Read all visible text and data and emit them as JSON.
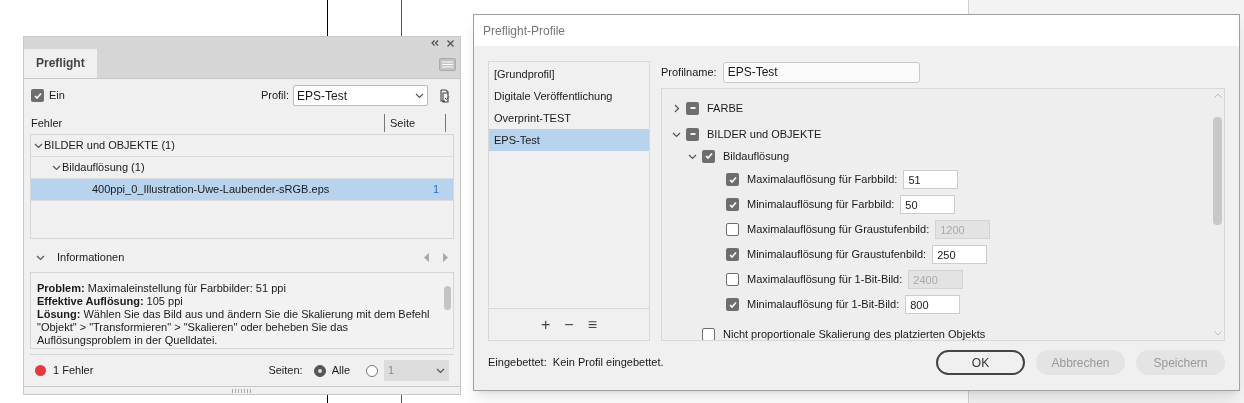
{
  "preflight_panel": {
    "tab": "Preflight",
    "enabled": {
      "label": "Ein",
      "checked": true
    },
    "profile": {
      "label": "Profil:",
      "value": "EPS-Test"
    },
    "columns": [
      "Fehler",
      "Seite"
    ],
    "errors": [
      {
        "label": "BILDER und OBJEKTE (1)",
        "selected": false,
        "expanded": true,
        "children": [
          {
            "label": "Bildauflösung (1)",
            "selected": false,
            "expanded": true,
            "children": [
              {
                "label": "400ppi_0_Illustration-Uwe-Laubender-sRGB.eps",
                "page": "1",
                "selected": true
              }
            ]
          }
        ]
      }
    ],
    "info_header": "Informationen",
    "info_lines": [
      "**Problem:** Maximaleinstellung für Farbbilder: 51 ppi",
      "**Effektive Auflösung:** 105 ppi",
      "**Lösung:** Wählen Sie das Bild aus und ändern Sie die Skalierung mit dem Befehl \"Objekt\" > \"Transformieren\" > \"Skalieren\" oder beheben Sie das Auflösungsproblem in der Quelldatei."
    ],
    "status": {
      "errors": "1 Fehler",
      "pages_label": "Seiten:",
      "options": [
        {
          "label": "Alle",
          "selected": true
        },
        {
          "label": "1",
          "selected": false
        }
      ]
    }
  },
  "dialog": {
    "title": "Preflight-Profile",
    "profiles": [
      {
        "label": "[Grundprofil]",
        "selected": false
      },
      {
        "label": "Digitale Veröffentlichung",
        "selected": false
      },
      {
        "label": "Overprint-TEST",
        "selected": false
      },
      {
        "label": "EPS-Test",
        "selected": true
      }
    ],
    "list_buttons": [
      "+",
      "−",
      "≡"
    ],
    "profile_name": {
      "label": "Profilname:",
      "value": "EPS-Test"
    },
    "tree": [
      {
        "label": "FARBE",
        "checked": true,
        "mixed": true,
        "expanded": false
      },
      {
        "label": "BILDER und OBJEKTE",
        "checked": true,
        "mixed": true,
        "expanded": true,
        "children": [
          {
            "label": "Bildauflösung",
            "checked": true,
            "mixed": false,
            "expanded": true,
            "children": [
              {
                "label": "Maximalauflösung für Farbbild:",
                "checked": true,
                "mixed": false,
                "value": "51",
                "disabled": false
              },
              {
                "label": "Minimalauflösung für Farbbild:",
                "checked": true,
                "mixed": false,
                "value": "50",
                "disabled": false
              },
              {
                "label": "Maximalauflösung für Graustufenbild:",
                "checked": false,
                "mixed": false,
                "value": "1200",
                "disabled": true
              },
              {
                "label": "Minimalauflösung für Graustufenbild:",
                "checked": true,
                "mixed": false,
                "value": "250",
                "disabled": false
              },
              {
                "label": "Maximalauflösung für 1-Bit-Bild:",
                "checked": false,
                "mixed": false,
                "value": "2400",
                "disabled": true
              },
              {
                "label": "Minimalauflösung für 1-Bit-Bild:",
                "checked": true,
                "mixed": false,
                "value": "800",
                "disabled": false
              }
            ]
          },
          {
            "label": "Nicht proportionale Skalierung des platzierten Objekts",
            "checked": false,
            "mixed": false
          }
        ]
      }
    ],
    "embedded": "Eingebettet:  Kein Profil eingebettet.",
    "buttons": [
      {
        "label": "OK",
        "disabled": false
      },
      {
        "label": "Abbrechen",
        "disabled": true
      },
      {
        "label": "Speichern",
        "disabled": true
      }
    ]
  }
}
